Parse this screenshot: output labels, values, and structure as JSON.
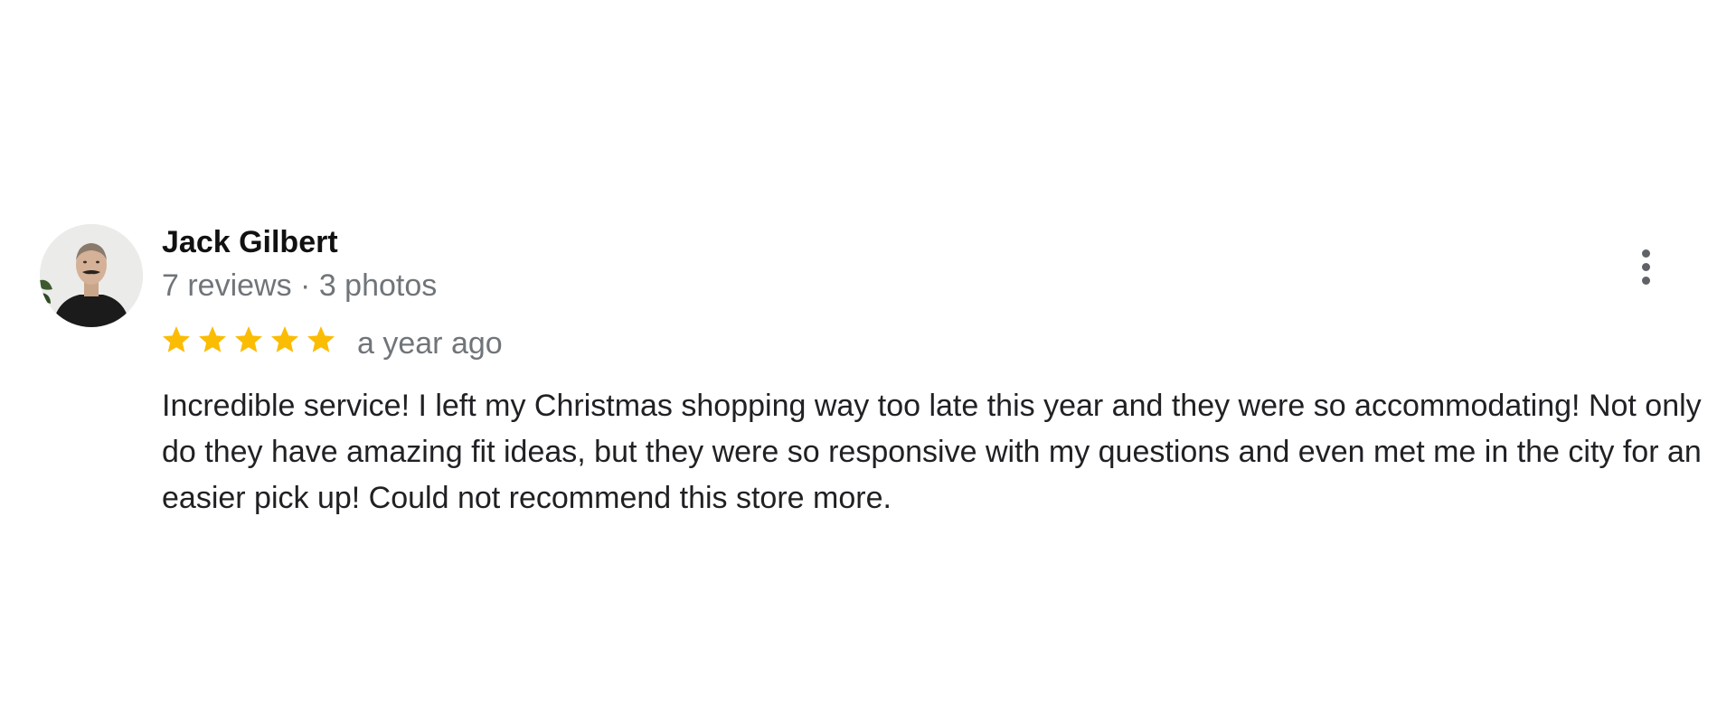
{
  "review": {
    "author": {
      "name": "Jack Gilbert",
      "meta": "7 reviews · 3 photos",
      "avatar_icon": "user-avatar-photo"
    },
    "rating": {
      "value": 5,
      "max": 5,
      "star_color": "#fbbc04"
    },
    "timestamp": "a year ago",
    "text": "Incredible service! I left my Christmas shopping way too late this year and they were so accommodating! Not only do they have amazing fit ideas, but they were so responsive with my questions and even met me in the city for an easier pick up! Could not recommend this store more.",
    "actions_icon": "more-vert-icon"
  },
  "colors": {
    "name": "#111111",
    "secondary_text": "#70757a",
    "body_text": "#202124",
    "icon": "#5f6368"
  }
}
